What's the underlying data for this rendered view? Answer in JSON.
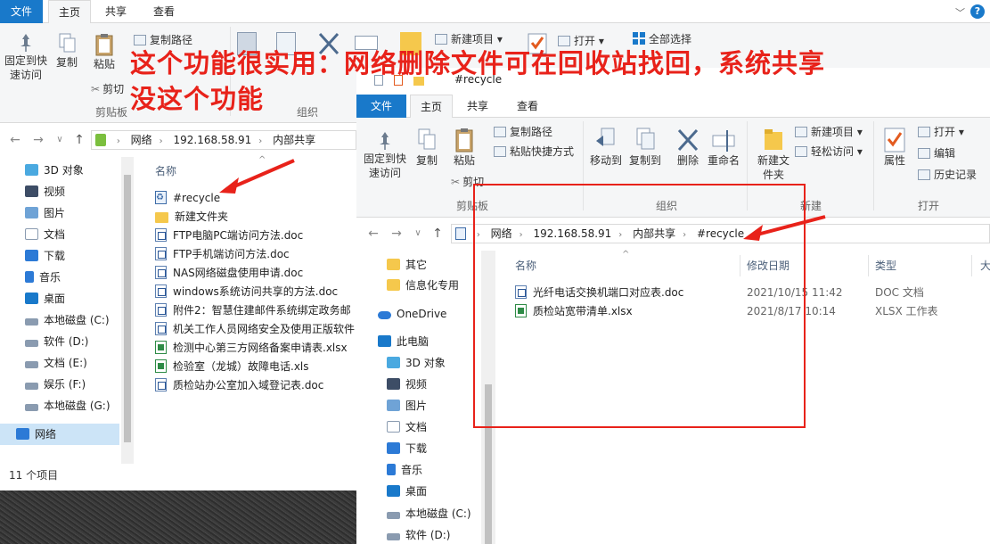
{
  "annotation": {
    "line1": "这个功能很实用：网络删除文件可在回收站找回，系统共享",
    "line2": "没这个功能"
  },
  "win1": {
    "tabs": [
      "文件",
      "主页",
      "共享",
      "查看"
    ],
    "ribbon": {
      "pin": "固定到快速访问",
      "copy": "复制",
      "paste": "粘贴",
      "copy_path": "复制路径",
      "cut": "剪切",
      "group_clipboard": "剪贴板",
      "group_organize": "组织",
      "new_item": "新建项目",
      "open": "打开",
      "select_all": "全部选择"
    },
    "path": [
      "网络",
      "192.168.58.91",
      "内部共享"
    ],
    "nav": [
      "3D 对象",
      "视频",
      "图片",
      "文档",
      "下载",
      "音乐",
      "桌面",
      "本地磁盘 (C:)",
      "软件 (D:)",
      "文档 (E:)",
      "娱乐 (F:)",
      "本地磁盘 (G:)",
      "网络"
    ],
    "col_name": "名称",
    "files": [
      "#recycle",
      "新建文件夹",
      "FTP电脑PC端访问方法.doc",
      "FTP手机端访问方法.doc",
      "NAS网络磁盘使用申请.doc",
      "windows系统访问共享的方法.doc",
      "附件2：智慧住建邮件系统绑定政务邮",
      "机关工作人员网络安全及使用正版软件",
      "检测中心第三方网络备案申请表.xlsx",
      "检验室（龙城）故障电话.xls",
      "质检站办公室加入域登记表.doc"
    ],
    "status": "11 个项目"
  },
  "win2": {
    "title": "#recycle",
    "tabs": [
      "文件",
      "主页",
      "共享",
      "查看"
    ],
    "ribbon": {
      "pin": "固定到快速访问",
      "copy": "复制",
      "paste": "粘贴",
      "copy_path": "复制路径",
      "paste_shortcut": "粘贴快捷方式",
      "cut": "剪切",
      "group_clipboard": "剪贴板",
      "move_to": "移动到",
      "copy_to": "复制到",
      "delete": "删除",
      "rename": "重命名",
      "group_organize": "组织",
      "new_folder": "新建文件夹",
      "new_item": "新建项目",
      "easy_access": "轻松访问",
      "group_new": "新建",
      "properties": "属性",
      "open": "打开",
      "edit": "编辑",
      "history": "历史记录",
      "group_open": "打开"
    },
    "path": [
      "网络",
      "192.168.58.91",
      "内部共享",
      "#recycle"
    ],
    "nav": [
      "其它",
      "信息化专用",
      "OneDrive",
      "此电脑",
      "3D 对象",
      "视频",
      "图片",
      "文档",
      "下载",
      "音乐",
      "桌面",
      "本地磁盘 (C:)",
      "软件 (D:)"
    ],
    "cols": [
      "名称",
      "修改日期",
      "类型",
      "大"
    ],
    "files": [
      {
        "name": "光纤电话交换机端口对应表.doc",
        "date": "2021/10/15 11:42",
        "type": "DOC 文档"
      },
      {
        "name": "质检站宽带清单.xlsx",
        "date": "2021/8/17 10:14",
        "type": "XLSX 工作表"
      }
    ]
  }
}
